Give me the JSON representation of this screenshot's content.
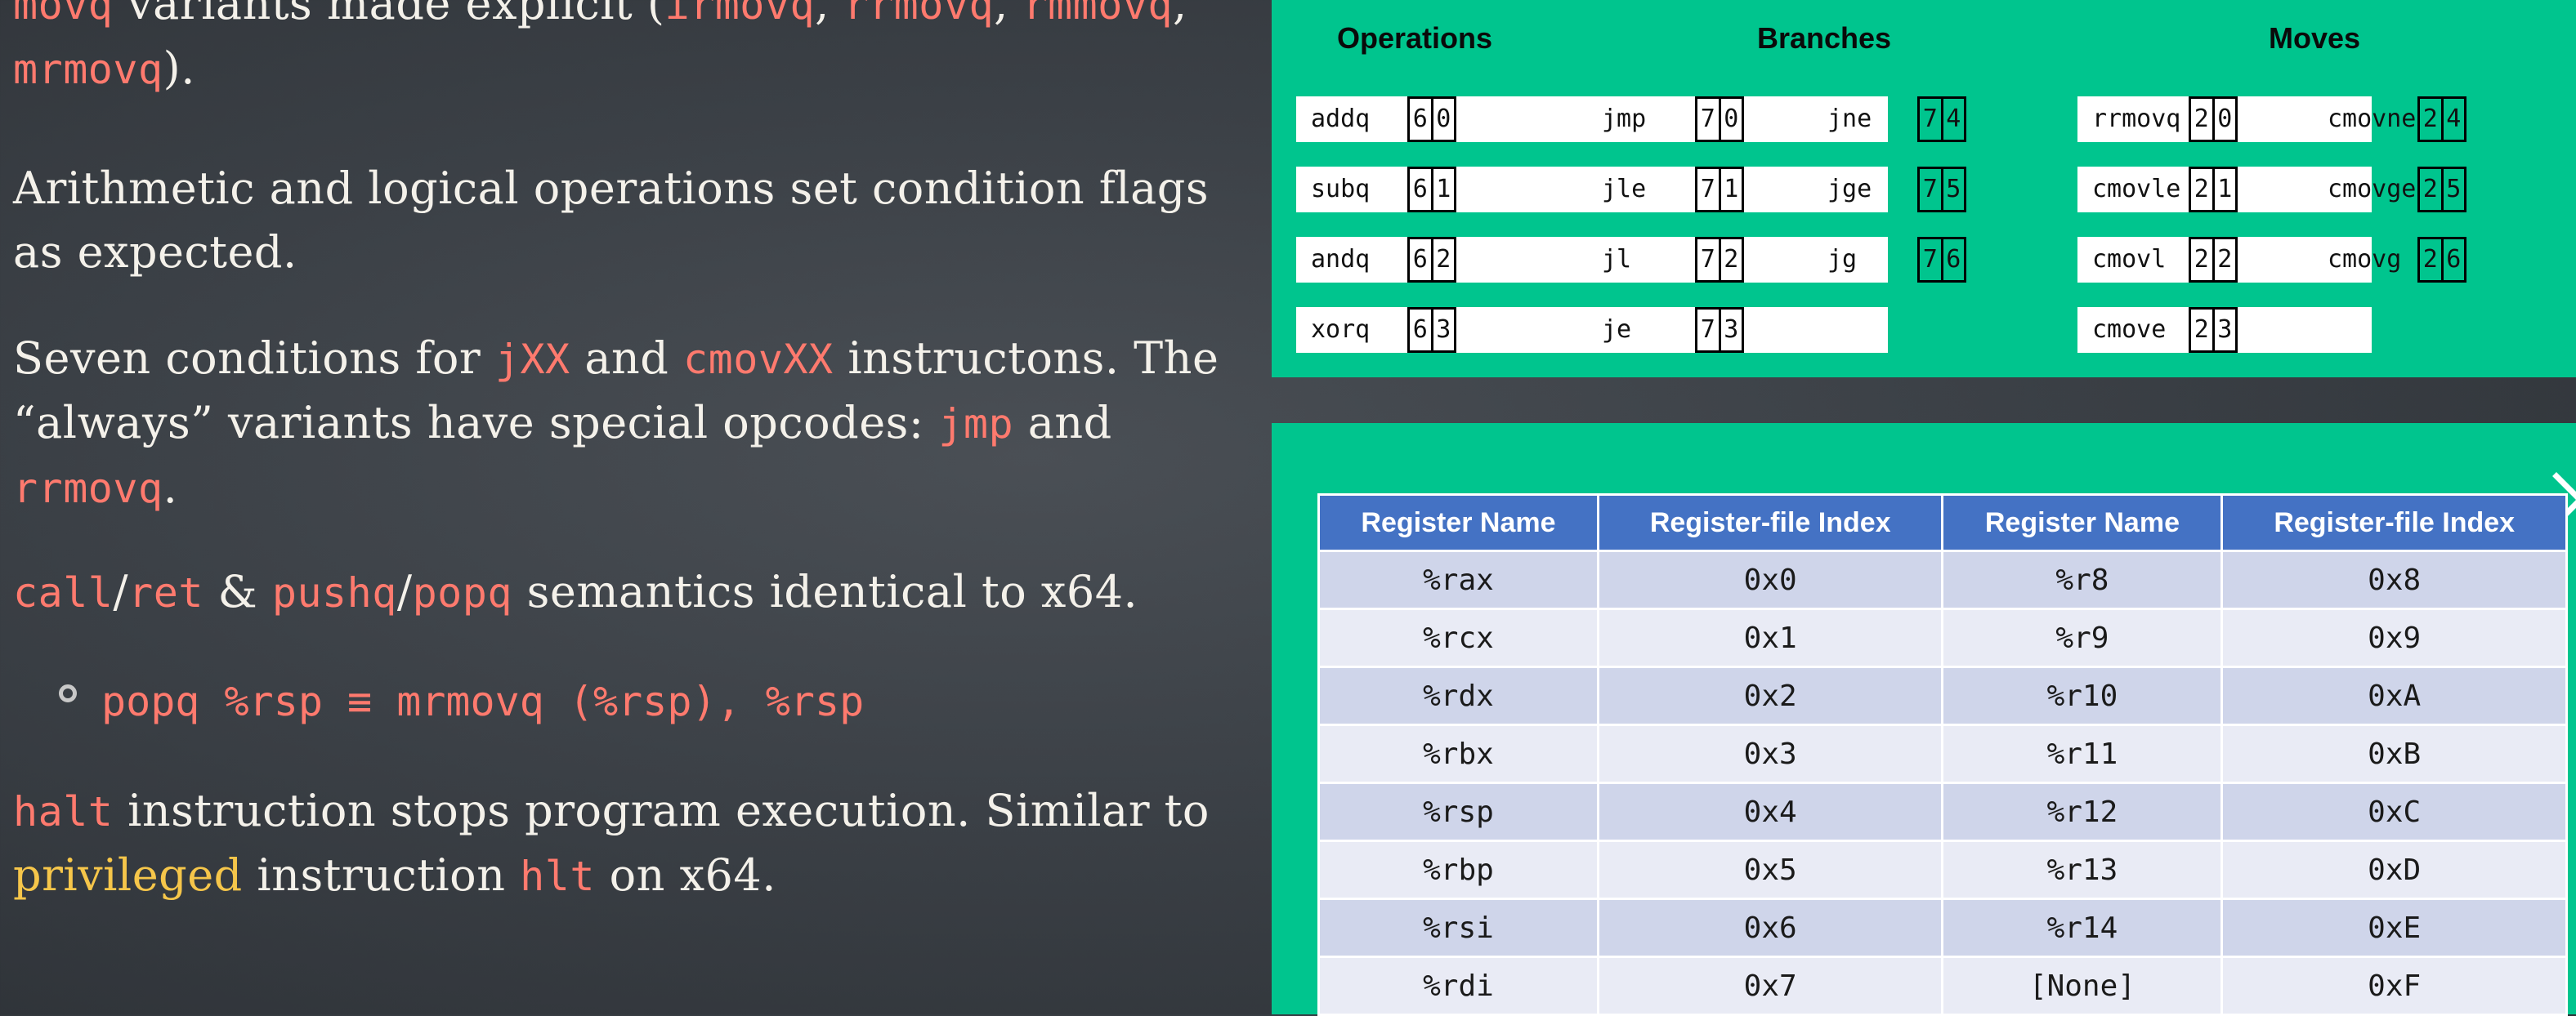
{
  "slide": {
    "p1": {
      "code1": "movq",
      "t1": " variants made explicit (",
      "code2": "irmovq",
      "t2": ", ",
      "code3": "rrmovq",
      "t3": ", ",
      "code4": "rmmovq",
      "t4": ",",
      "code5": "mrmovq",
      "t5": ")."
    },
    "p2": {
      "t1": "Arithmetic and logical operations set condition flags as expected."
    },
    "p3": {
      "t1": "Seven conditions for ",
      "code1": "jXX",
      "t2": " and ",
      "code2": "cmovXX",
      "t3": " instructons. The “always” variants have special opcodes: ",
      "code3": "jmp",
      "t4": " and ",
      "code4": "rrmovq",
      "t5": "."
    },
    "p4": {
      "code1": "call",
      "t1": "/",
      "code2": "ret",
      "t2": " & ",
      "code3": "pushq",
      "t3": "/",
      "code4": "popq",
      "t4": " semantics identical to x64."
    },
    "bullet": {
      "text": "popq %rsp ≡ mrmovq (%rsp), %rsp"
    },
    "p5": {
      "code1": "halt",
      "t1": " instruction stops program execution. Similar to ",
      "hl1": "privileged",
      "t2": " instruction ",
      "code2": "hlt",
      "t3": " on x64."
    }
  },
  "instructions": {
    "headers": {
      "operations": "Operations",
      "branches": "Branches",
      "moves": "Moves"
    },
    "operations": [
      {
        "name": "addq",
        "codes": [
          "6",
          "0"
        ]
      },
      {
        "name": "subq",
        "codes": [
          "6",
          "1"
        ]
      },
      {
        "name": "andq",
        "codes": [
          "6",
          "2"
        ]
      },
      {
        "name": "xorq",
        "codes": [
          "6",
          "3"
        ]
      }
    ],
    "branches": [
      {
        "name": "jmp",
        "codes": [
          "7",
          "0"
        ]
      },
      {
        "name": "jle",
        "codes": [
          "7",
          "1"
        ]
      },
      {
        "name": "jl",
        "codes": [
          "7",
          "2"
        ]
      },
      {
        "name": "je",
        "codes": [
          "7",
          "3"
        ]
      },
      {
        "name": "jne",
        "codes": [
          "7",
          "4"
        ]
      },
      {
        "name": "jge",
        "codes": [
          "7",
          "5"
        ]
      },
      {
        "name": "jg",
        "codes": [
          "7",
          "6"
        ]
      }
    ],
    "moves": [
      {
        "name": "rrmovq",
        "codes": [
          "2",
          "0"
        ]
      },
      {
        "name": "cmovle",
        "codes": [
          "2",
          "1"
        ]
      },
      {
        "name": "cmovl",
        "codes": [
          "2",
          "2"
        ]
      },
      {
        "name": "cmove",
        "codes": [
          "2",
          "3"
        ]
      },
      {
        "name": "cmovne",
        "codes": [
          "2",
          "4"
        ]
      },
      {
        "name": "cmovge",
        "codes": [
          "2",
          "5"
        ]
      },
      {
        "name": "cmovg",
        "codes": [
          "2",
          "6"
        ]
      }
    ]
  },
  "registers": {
    "headers": [
      "Register Name",
      "Register-file Index",
      "Register Name",
      "Register-file Index"
    ],
    "rows": [
      [
        "%rax",
        "0x0",
        "%r8",
        "0x8"
      ],
      [
        "%rcx",
        "0x1",
        "%r9",
        "0x9"
      ],
      [
        "%rdx",
        "0x2",
        "%r10",
        "0xA"
      ],
      [
        "%rbx",
        "0x3",
        "%r11",
        "0xB"
      ],
      [
        "%rsp",
        "0x4",
        "%r12",
        "0xC"
      ],
      [
        "%rbp",
        "0x5",
        "%r13",
        "0xD"
      ],
      [
        "%rsi",
        "0x6",
        "%r14",
        "0xE"
      ],
      [
        "%rdi",
        "0x7",
        "[None]",
        "0xF"
      ]
    ]
  },
  "icons": {
    "next": "chevron-right-icon",
    "bullet": "bullet-dot-icon"
  },
  "colors": {
    "panel": "#00c58e",
    "code_text": "#ff7a6e",
    "highlight": "#f6c64a",
    "table_header": "#4472c4"
  }
}
